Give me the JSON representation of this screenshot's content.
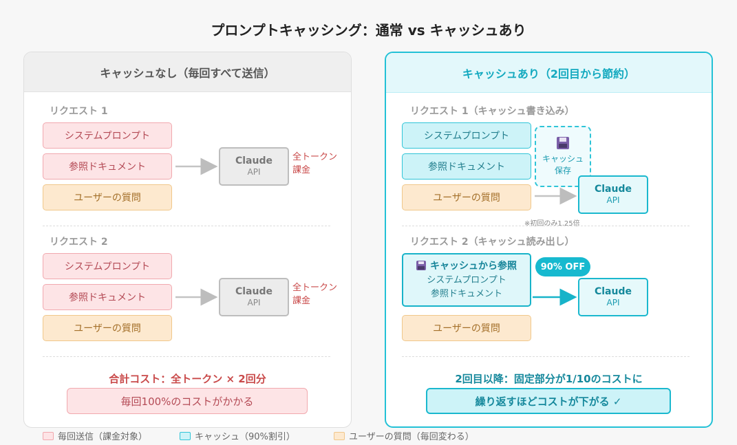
{
  "title": "プロンプトキャッシング：通常 vs キャッシュあり",
  "left": {
    "header": "キャッシュなし（毎回すべて送信）",
    "req1_label": "リクエスト 1",
    "req2_label": "リクエスト 2",
    "system_prompt": "システムプロンプト",
    "ref_doc": "参照ドキュメント",
    "user_question": "ユーザーの質問",
    "api_title": "Claude",
    "api_sub": "API",
    "charge_line1": "全トークン",
    "charge_line2": "課金",
    "summary_title": "合計コスト：全トークン × 2回分",
    "summary_box": "毎回100%のコストがかかる"
  },
  "right": {
    "header": "キャッシュあり（2回目から節約）",
    "req1_label": "リクエスト 1（キャッシュ書き込み）",
    "req2_label": "リクエスト 2（キャッシュ読み出し）",
    "system_prompt": "システムプロンプト",
    "ref_doc": "参照ドキュメント",
    "user_question": "ユーザーの質問",
    "cache_save_line1": "キャッシュ",
    "cache_save_line2": "保存",
    "api_title": "Claude",
    "api_sub": "API",
    "first_note": "※初回のみ1.25倍",
    "ref_head": "キャッシュから参照",
    "ref_line1": "システムプロンプト",
    "ref_line2": "参照ドキュメント",
    "badge": "90% OFF",
    "summary_title": "2回目以降：固定部分が1/10のコストに",
    "summary_box": "繰り返すほどコストが下がる ✓"
  },
  "legend": [
    {
      "label": "毎回送信（課金対象）",
      "fill": "#fde4e6",
      "stroke": "#f1a8ae"
    },
    {
      "label": "キャッシュ（90%割引）",
      "fill": "#cdf3f8",
      "stroke": "#2ec4d7"
    },
    {
      "label": "ユーザーの質問（毎回変わる）",
      "fill": "#fde9cf",
      "stroke": "#f0c78a"
    }
  ],
  "colors": {
    "accent": "#17b9cf",
    "charge_red": "#c94a4a"
  }
}
